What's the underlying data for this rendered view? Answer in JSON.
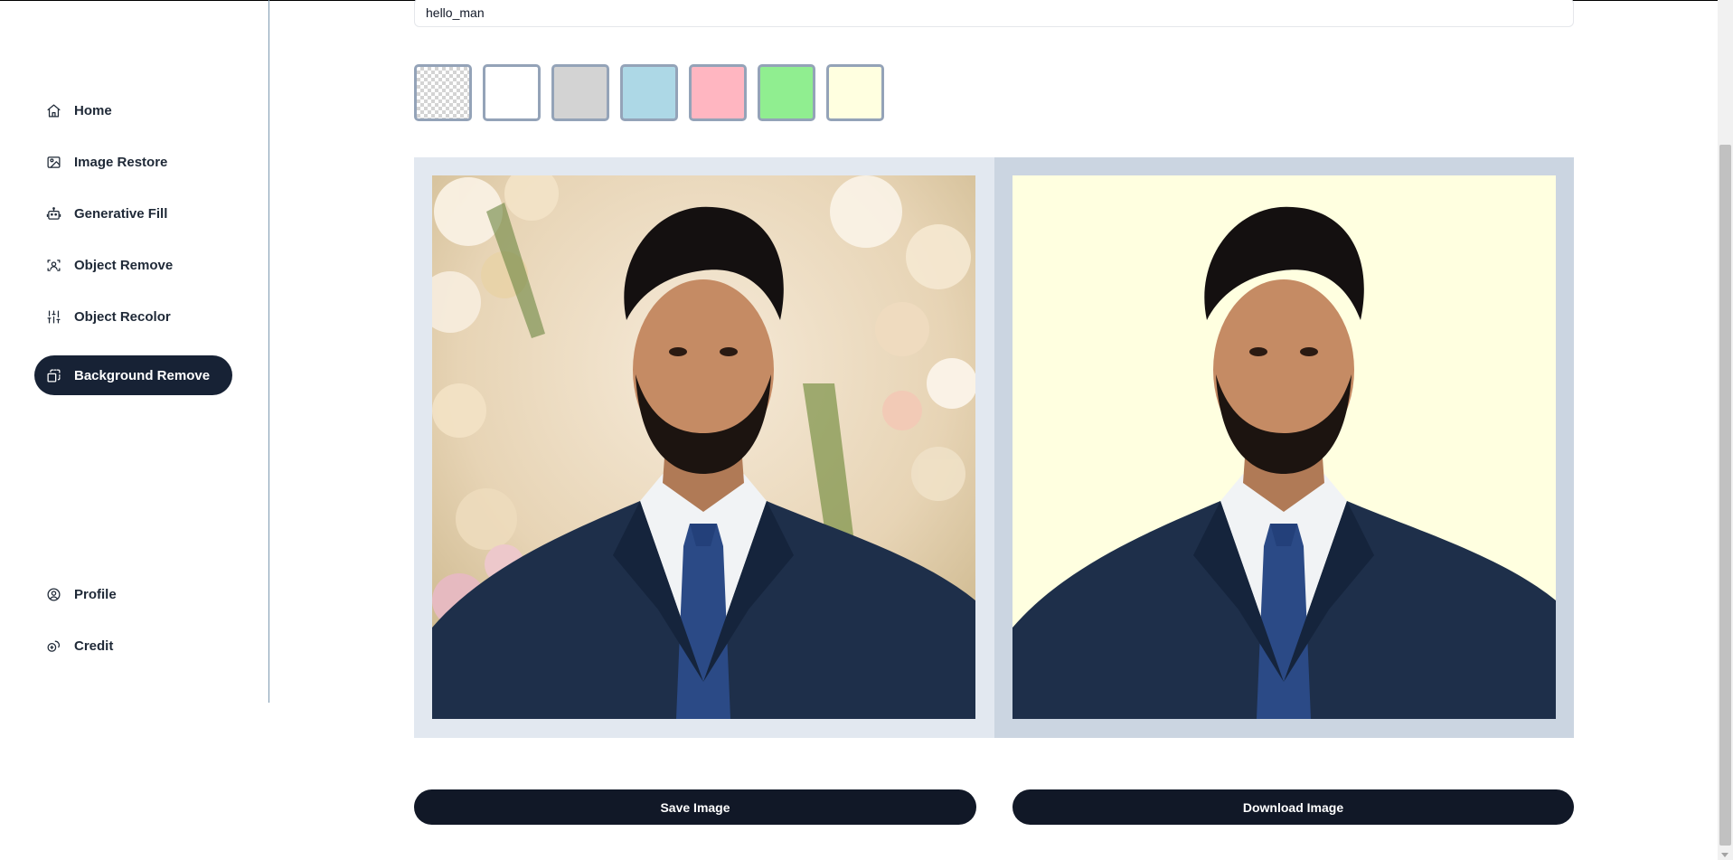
{
  "sidebar": {
    "items": [
      {
        "label": "Home",
        "icon": "home-icon",
        "active": false
      },
      {
        "label": "Image Restore",
        "icon": "image-icon",
        "active": false
      },
      {
        "label": "Generative Fill",
        "icon": "bot-icon",
        "active": false
      },
      {
        "label": "Object Remove",
        "icon": "scan-icon",
        "active": false
      },
      {
        "label": "Object Recolor",
        "icon": "sliders-icon",
        "active": false
      },
      {
        "label": "Background Remove",
        "icon": "layers-icon",
        "active": true
      }
    ],
    "bottom_items": [
      {
        "label": "Profile",
        "icon": "user-circle-icon"
      },
      {
        "label": "Credit",
        "icon": "coins-icon"
      }
    ]
  },
  "main": {
    "image_name": "hello_man",
    "swatches": [
      {
        "name": "transparent",
        "color": "transparent"
      },
      {
        "name": "white",
        "color": "#ffffff"
      },
      {
        "name": "light-gray",
        "color": "#d3d3d3"
      },
      {
        "name": "light-blue",
        "color": "#add8e6"
      },
      {
        "name": "pink",
        "color": "#ffb6c1"
      },
      {
        "name": "light-green",
        "color": "#90ee90"
      },
      {
        "name": "light-yellow",
        "color": "#ffffe0"
      }
    ],
    "selected_background": "#ffffe0",
    "save_label": "Save Image",
    "download_label": "Download Image"
  },
  "colors": {
    "primary": "#111827",
    "active_nav": "#172235",
    "panel_left": "#e2e8f0",
    "panel_right": "#cbd5e1"
  }
}
